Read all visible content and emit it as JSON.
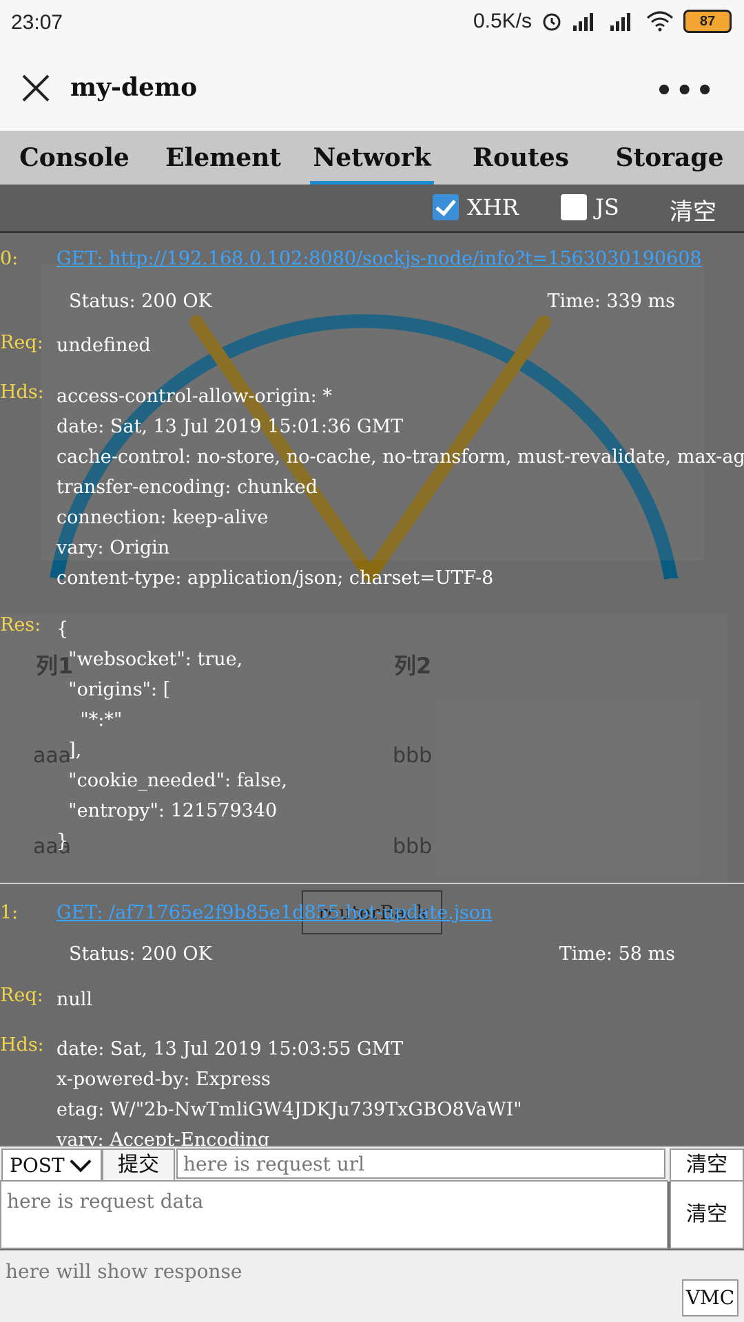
{
  "status_bar": {
    "time": "23:07",
    "net_speed": "0.5K/s",
    "battery": "87"
  },
  "header": {
    "title": "my-demo"
  },
  "tabs": [
    {
      "label": "Console"
    },
    {
      "label": "Element"
    },
    {
      "label": "Network"
    },
    {
      "label": "Routes"
    },
    {
      "label": "Storage"
    }
  ],
  "active_tab": "Network",
  "filter": {
    "xhr_label": "XHR",
    "js_label": "JS",
    "clear_label": "清空",
    "xhr_checked": true,
    "js_checked": false
  },
  "labels": {
    "req": "Req:",
    "hds": "Hds:",
    "res": "Res:"
  },
  "requests": [
    {
      "index": "0:",
      "url": "GET: http://192.168.0.102:8080/sockjs-node/info?t=1563030190608",
      "status": "Status: 200 OK",
      "time": "Time: 339 ms",
      "req": "undefined",
      "headers": [
        "access-control-allow-origin: *",
        "date: Sat, 13 Jul 2019 15:01:36 GMT",
        "cache-control: no-store, no-cache, no-transform, must-revalidate, max-age",
        "transfer-encoding: chunked",
        "connection: keep-alive",
        "vary: Origin",
        "content-type: application/json; charset=UTF-8"
      ],
      "response": [
        "{",
        "  \"websocket\": true,",
        "  \"origins\": [",
        "    \"*:*\"",
        "  ],",
        "  \"cookie_needed\": false,",
        "  \"entropy\": 121579340",
        "}"
      ]
    },
    {
      "index": "1:",
      "url": "GET: /af71765e2f9b85e1d855.hot-update.json",
      "status": "Status: 200 OK",
      "time": "Time: 58 ms",
      "req": "null",
      "headers": [
        "date: Sat, 13 Jul 2019 15:03:55 GMT",
        "x-powered-by: Express",
        "etag: W/\"2b-NwTmliGW4JDKJu739TxGBO8VaWI\"",
        "vary: Accept-Encoding"
      ]
    }
  ],
  "background_page": {
    "col1": "列1",
    "col2": "列2",
    "rows": [
      [
        "aaa",
        "bbb"
      ],
      [
        "aaa",
        "bbb"
      ]
    ],
    "button": "routerBack"
  },
  "request_panel": {
    "method": "POST",
    "submit": "提交",
    "url_placeholder": "here is request url",
    "clear_url": "清空",
    "data_placeholder": "here is request data",
    "clear_data": "清空",
    "response_placeholder": "here will show response",
    "vmc": "VMC"
  },
  "colors": {
    "accent": "#1e8ccf",
    "label_yellow": "#f2d44a",
    "link": "#3aa4ff",
    "arc": "#0a5b82",
    "v_line": "#8a6a10"
  }
}
